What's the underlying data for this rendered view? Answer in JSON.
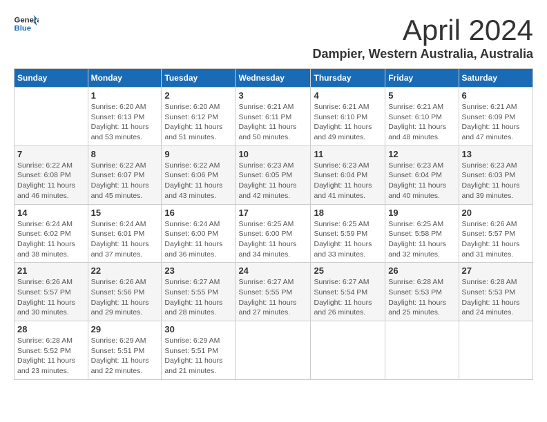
{
  "header": {
    "logo_general": "General",
    "logo_blue": "Blue",
    "month_title": "April 2024",
    "location": "Dampier, Western Australia, Australia"
  },
  "calendar": {
    "days_of_week": [
      "Sunday",
      "Monday",
      "Tuesday",
      "Wednesday",
      "Thursday",
      "Friday",
      "Saturday"
    ],
    "weeks": [
      [
        {
          "day": "",
          "info": ""
        },
        {
          "day": "1",
          "info": "Sunrise: 6:20 AM\nSunset: 6:13 PM\nDaylight: 11 hours\nand 53 minutes."
        },
        {
          "day": "2",
          "info": "Sunrise: 6:20 AM\nSunset: 6:12 PM\nDaylight: 11 hours\nand 51 minutes."
        },
        {
          "day": "3",
          "info": "Sunrise: 6:21 AM\nSunset: 6:11 PM\nDaylight: 11 hours\nand 50 minutes."
        },
        {
          "day": "4",
          "info": "Sunrise: 6:21 AM\nSunset: 6:10 PM\nDaylight: 11 hours\nand 49 minutes."
        },
        {
          "day": "5",
          "info": "Sunrise: 6:21 AM\nSunset: 6:10 PM\nDaylight: 11 hours\nand 48 minutes."
        },
        {
          "day": "6",
          "info": "Sunrise: 6:21 AM\nSunset: 6:09 PM\nDaylight: 11 hours\nand 47 minutes."
        }
      ],
      [
        {
          "day": "7",
          "info": "Sunrise: 6:22 AM\nSunset: 6:08 PM\nDaylight: 11 hours\nand 46 minutes."
        },
        {
          "day": "8",
          "info": "Sunrise: 6:22 AM\nSunset: 6:07 PM\nDaylight: 11 hours\nand 45 minutes."
        },
        {
          "day": "9",
          "info": "Sunrise: 6:22 AM\nSunset: 6:06 PM\nDaylight: 11 hours\nand 43 minutes."
        },
        {
          "day": "10",
          "info": "Sunrise: 6:23 AM\nSunset: 6:05 PM\nDaylight: 11 hours\nand 42 minutes."
        },
        {
          "day": "11",
          "info": "Sunrise: 6:23 AM\nSunset: 6:04 PM\nDaylight: 11 hours\nand 41 minutes."
        },
        {
          "day": "12",
          "info": "Sunrise: 6:23 AM\nSunset: 6:04 PM\nDaylight: 11 hours\nand 40 minutes."
        },
        {
          "day": "13",
          "info": "Sunrise: 6:23 AM\nSunset: 6:03 PM\nDaylight: 11 hours\nand 39 minutes."
        }
      ],
      [
        {
          "day": "14",
          "info": "Sunrise: 6:24 AM\nSunset: 6:02 PM\nDaylight: 11 hours\nand 38 minutes."
        },
        {
          "day": "15",
          "info": "Sunrise: 6:24 AM\nSunset: 6:01 PM\nDaylight: 11 hours\nand 37 minutes."
        },
        {
          "day": "16",
          "info": "Sunrise: 6:24 AM\nSunset: 6:00 PM\nDaylight: 11 hours\nand 36 minutes."
        },
        {
          "day": "17",
          "info": "Sunrise: 6:25 AM\nSunset: 6:00 PM\nDaylight: 11 hours\nand 34 minutes."
        },
        {
          "day": "18",
          "info": "Sunrise: 6:25 AM\nSunset: 5:59 PM\nDaylight: 11 hours\nand 33 minutes."
        },
        {
          "day": "19",
          "info": "Sunrise: 6:25 AM\nSunset: 5:58 PM\nDaylight: 11 hours\nand 32 minutes."
        },
        {
          "day": "20",
          "info": "Sunrise: 6:26 AM\nSunset: 5:57 PM\nDaylight: 11 hours\nand 31 minutes."
        }
      ],
      [
        {
          "day": "21",
          "info": "Sunrise: 6:26 AM\nSunset: 5:57 PM\nDaylight: 11 hours\nand 30 minutes."
        },
        {
          "day": "22",
          "info": "Sunrise: 6:26 AM\nSunset: 5:56 PM\nDaylight: 11 hours\nand 29 minutes."
        },
        {
          "day": "23",
          "info": "Sunrise: 6:27 AM\nSunset: 5:55 PM\nDaylight: 11 hours\nand 28 minutes."
        },
        {
          "day": "24",
          "info": "Sunrise: 6:27 AM\nSunset: 5:55 PM\nDaylight: 11 hours\nand 27 minutes."
        },
        {
          "day": "25",
          "info": "Sunrise: 6:27 AM\nSunset: 5:54 PM\nDaylight: 11 hours\nand 26 minutes."
        },
        {
          "day": "26",
          "info": "Sunrise: 6:28 AM\nSunset: 5:53 PM\nDaylight: 11 hours\nand 25 minutes."
        },
        {
          "day": "27",
          "info": "Sunrise: 6:28 AM\nSunset: 5:53 PM\nDaylight: 11 hours\nand 24 minutes."
        }
      ],
      [
        {
          "day": "28",
          "info": "Sunrise: 6:28 AM\nSunset: 5:52 PM\nDaylight: 11 hours\nand 23 minutes."
        },
        {
          "day": "29",
          "info": "Sunrise: 6:29 AM\nSunset: 5:51 PM\nDaylight: 11 hours\nand 22 minutes."
        },
        {
          "day": "30",
          "info": "Sunrise: 6:29 AM\nSunset: 5:51 PM\nDaylight: 11 hours\nand 21 minutes."
        },
        {
          "day": "",
          "info": ""
        },
        {
          "day": "",
          "info": ""
        },
        {
          "day": "",
          "info": ""
        },
        {
          "day": "",
          "info": ""
        }
      ]
    ]
  }
}
